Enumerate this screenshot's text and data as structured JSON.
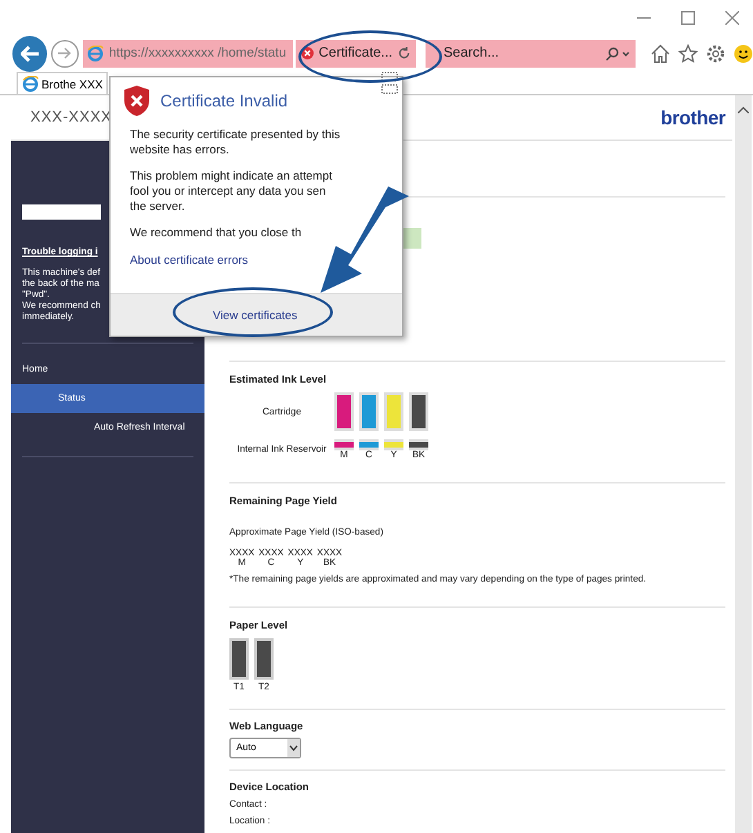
{
  "toolbar": {
    "url": "https://xxxxxxxxxx /home/statu",
    "certificate_label": "Certificate...",
    "search_placeholder": "Search..."
  },
  "tab": {
    "title": "Brothe XXX"
  },
  "page": {
    "model": "XXX-XXXX",
    "logo": "brother"
  },
  "sidebar": {
    "login_link": "Trouble logging i",
    "notice_lines": [
      "This machine's def",
      "the back of the ma",
      "\"Pwd\".",
      "We recommend ch",
      "immediately."
    ],
    "items": [
      {
        "label": "Home",
        "selected": false,
        "children": [
          {
            "label": "Status",
            "selected": true,
            "children": [
              {
                "label": "Auto Refresh Interval",
                "selected": false
              }
            ]
          }
        ]
      }
    ]
  },
  "popup": {
    "title": "Certificate Invalid",
    "paragraphs": [
      [
        "The security certificate presented by this",
        "website has errors."
      ],
      [
        "This problem might indicate an attempt",
        "fool you or intercept any data you sen",
        "the server."
      ],
      [
        "We recommend that you close th"
      ]
    ],
    "link": "About certificate errors",
    "button": "View certificates"
  },
  "ink": {
    "title": "Estimated Ink Level",
    "cartridge_label": "Cartridge",
    "reservoir_label": "Internal Ink Reservoir",
    "colors": [
      {
        "label": "M",
        "color": "#d81b7d",
        "cartridge": {
          "level": 1
        },
        "reservoir": {
          "level": 1
        }
      },
      {
        "label": "C",
        "color": "#1e9ad6",
        "cartridge": {
          "level": 1
        },
        "reservoir": {
          "level": 1
        }
      },
      {
        "label": "Y",
        "color": "#ede43a",
        "cartridge": {
          "level": 1
        },
        "reservoir": {
          "level": 1
        }
      },
      {
        "label": "BK",
        "color": "#4a4a4a",
        "cartridge": {
          "level": 1
        },
        "reservoir": {
          "level": 1
        }
      }
    ]
  },
  "yield": {
    "title": "Remaining Page Yield",
    "subtitle": "Approximate Page Yield (ISO-based)",
    "values": [
      {
        "value": "XXXX",
        "label": "M"
      },
      {
        "value": "XXXX",
        "label": "C"
      },
      {
        "value": "XXXX",
        "label": "Y"
      },
      {
        "value": "XXXX",
        "label": "BK"
      }
    ],
    "note": "*The remaining page yields are approximated and may vary depending on the type of pages printed."
  },
  "paper": {
    "title": "Paper Level",
    "trays": [
      {
        "label": "T1",
        "level": 1
      },
      {
        "label": "T2",
        "level": 1
      }
    ]
  },
  "language": {
    "title": "Web Language",
    "value": "Auto"
  },
  "location": {
    "title": "Device Location",
    "fields": [
      "Contact :",
      "Location :"
    ]
  }
}
